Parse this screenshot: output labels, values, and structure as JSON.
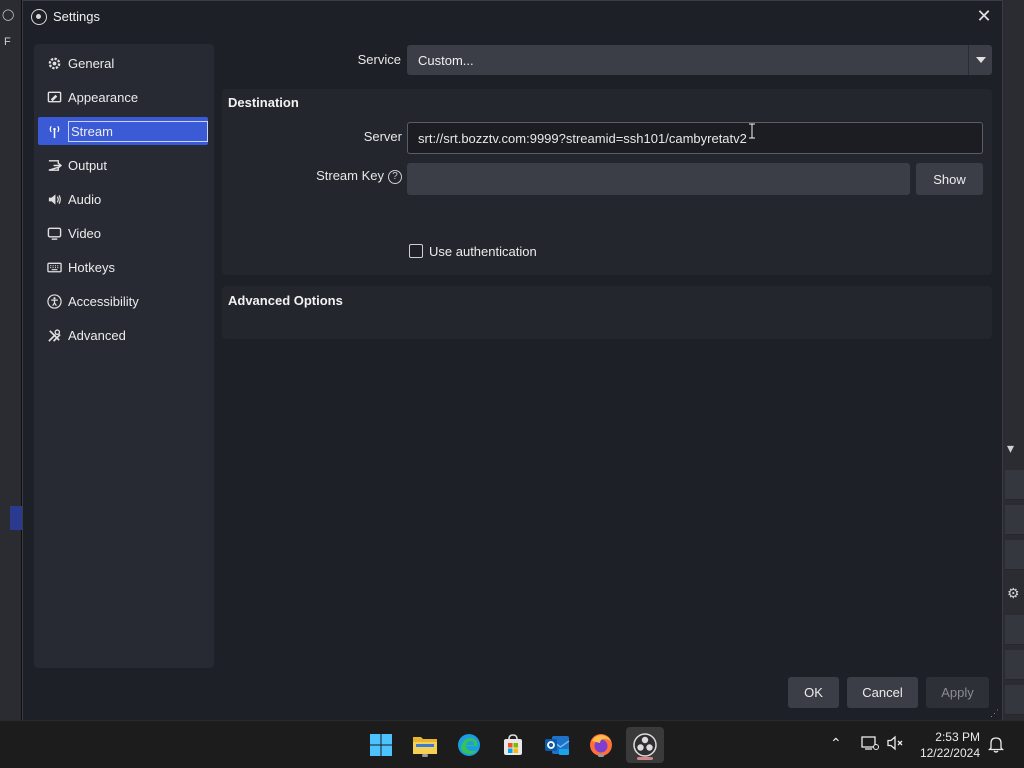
{
  "window": {
    "title": "Settings"
  },
  "sidebar": {
    "items": [
      {
        "label": "General",
        "icon": "gear-icon"
      },
      {
        "label": "Appearance",
        "icon": "appearance-icon"
      },
      {
        "label": "Stream",
        "icon": "antenna-icon",
        "active": true
      },
      {
        "label": "Output",
        "icon": "output-icon"
      },
      {
        "label": "Audio",
        "icon": "speaker-icon"
      },
      {
        "label": "Video",
        "icon": "monitor-icon"
      },
      {
        "label": "Hotkeys",
        "icon": "keyboard-icon"
      },
      {
        "label": "Accessibility",
        "icon": "accessibility-icon"
      },
      {
        "label": "Advanced",
        "icon": "tools-icon"
      }
    ]
  },
  "stream": {
    "service_label": "Service",
    "service_value": "Custom...",
    "destination_title": "Destination",
    "server_label": "Server",
    "server_value": "srt://srt.bozztv.com:9999?streamid=ssh101/cambyretatv2",
    "stream_key_label": "Stream Key",
    "stream_key_value": "",
    "show_button": "Show",
    "use_auth_label": "Use authentication",
    "use_auth_checked": false,
    "advanced_title": "Advanced Options"
  },
  "footer": {
    "ok": "OK",
    "cancel": "Cancel",
    "apply": "Apply"
  },
  "taskbar": {
    "time": "2:53 PM",
    "date": "12/22/2024"
  },
  "colors": {
    "accent": "#3b5bd6",
    "background": "#1e2027",
    "panel": "#272a33"
  }
}
